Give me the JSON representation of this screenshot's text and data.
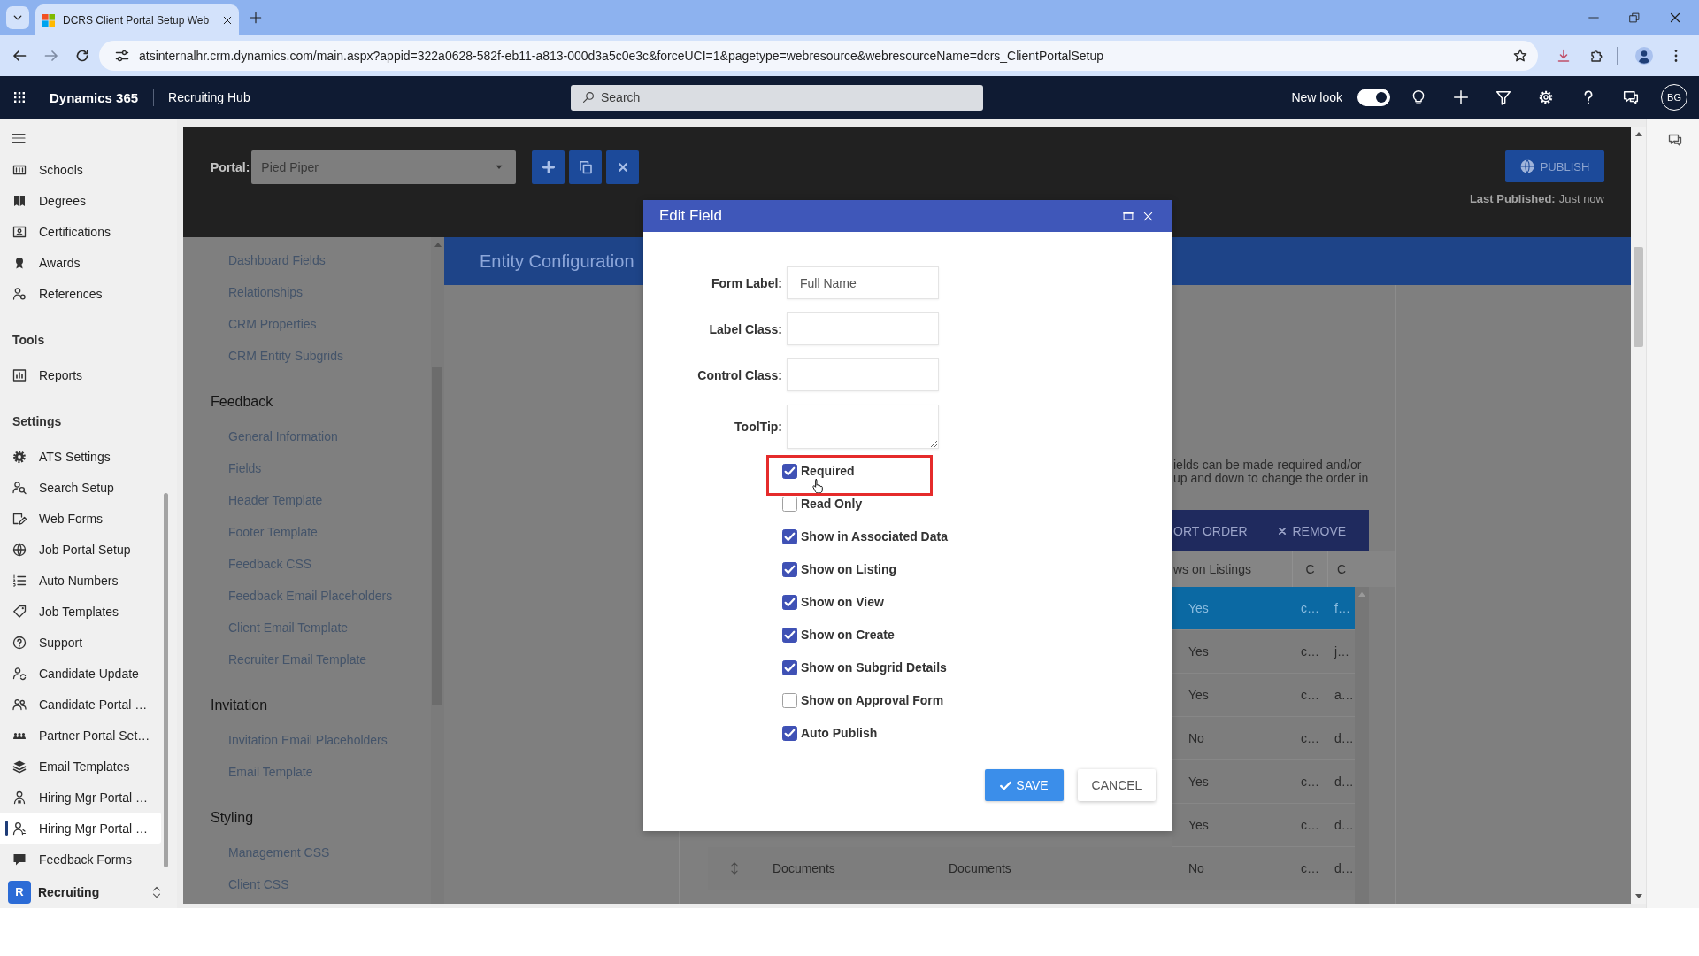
{
  "browser": {
    "tab_title": "DCRS Client Portal Setup Web",
    "url": "atsinternalhr.crm.dynamics.com/main.aspx?appid=322a0628-582f-eb11-a813-000d3a5c0e3c&forceUCI=1&pagetype=webresource&webresourceName=dcrs_ClientPortalSetup"
  },
  "app_header": {
    "app_name": "Dynamics 365",
    "area_name": "Recruiting Hub",
    "search": {
      "placeholder": "Search"
    },
    "new_look": {
      "label": "New look",
      "on": true
    },
    "avatar_initials": "BG"
  },
  "sidebar": {
    "groups": [
      {
        "items": [
          {
            "label": "Schools",
            "selected": false
          },
          {
            "label": "Degrees",
            "selected": false
          },
          {
            "label": "Certifications",
            "selected": false
          },
          {
            "label": "Awards",
            "selected": false
          },
          {
            "label": "References",
            "selected": false
          }
        ]
      },
      {
        "title": "Tools",
        "items": [
          {
            "label": "Reports",
            "selected": false
          }
        ]
      },
      {
        "title": "Settings",
        "items": [
          {
            "label": "ATS Settings",
            "selected": false
          },
          {
            "label": "Search Setup",
            "selected": false
          },
          {
            "label": "Web Forms",
            "selected": false
          },
          {
            "label": "Job Portal Setup",
            "selected": false
          },
          {
            "label": "Auto Numbers",
            "selected": false
          },
          {
            "label": "Job Templates",
            "selected": false
          },
          {
            "label": "Support",
            "selected": false
          },
          {
            "label": "Candidate Update",
            "selected": false
          },
          {
            "label": "Candidate Portal …",
            "selected": false
          },
          {
            "label": "Partner Portal Set…",
            "selected": false
          },
          {
            "label": "Email Templates",
            "selected": false
          },
          {
            "label": "Hiring Mgr Portal …",
            "selected": false
          },
          {
            "label": "Hiring Mgr Portal …",
            "selected": true
          },
          {
            "label": "Feedback Forms",
            "selected": false
          }
        ]
      }
    ],
    "area_switcher": {
      "badge": "R",
      "label": "Recruiting"
    }
  },
  "portal_bar": {
    "label": "Portal:",
    "portal": "Pied Piper",
    "publish_button": "PUBLISH",
    "last_published_label": "Last Published:",
    "last_published_value": "Just now"
  },
  "config_nav": {
    "groups": [
      {
        "items": [
          {
            "label": "Dashboard Fields",
            "selected": false
          },
          {
            "label": "Relationships",
            "selected": false
          },
          {
            "label": "CRM Properties",
            "selected": false
          },
          {
            "label": "CRM Entity Subgrids",
            "selected": false
          }
        ]
      },
      {
        "title": "Feedback",
        "items": [
          {
            "label": "General Information",
            "selected": false
          },
          {
            "label": "Fields",
            "selected": false
          },
          {
            "label": "Header Template",
            "selected": false
          },
          {
            "label": "Footer Template",
            "selected": false
          },
          {
            "label": "Feedback CSS",
            "selected": false
          },
          {
            "label": "Feedback Email Placeholders",
            "selected": false
          },
          {
            "label": "Client Email Template",
            "selected": false
          },
          {
            "label": "Recruiter Email Template",
            "selected": false
          }
        ]
      },
      {
        "title": "Invitation",
        "items": [
          {
            "label": "Invitation Email Placeholders",
            "selected": false
          },
          {
            "label": "Email Template",
            "selected": false
          }
        ]
      },
      {
        "title": "Styling",
        "items": [
          {
            "label": "Management CSS",
            "selected": false
          },
          {
            "label": "Client CSS",
            "selected": false
          }
        ]
      }
    ]
  },
  "entity_configuration": {
    "title": "Entity Configuration",
    "description_lines": [
      "ields can be made required and/or",
      "up and down to change the order in"
    ],
    "toolbar": [
      {
        "kind": "sort",
        "label": "ORT ORDER"
      },
      {
        "kind": "remove",
        "label": "REMOVE"
      }
    ],
    "table": {
      "columns": [
        "",
        "",
        "ws on Listings",
        "C",
        "C"
      ],
      "rows": [
        {
          "selected": true,
          "cells": [
            "",
            "",
            "Yes",
            "c…",
            "f…"
          ]
        },
        {
          "selected": false,
          "cells": [
            "",
            "",
            "Yes",
            "c…",
            "j…"
          ]
        },
        {
          "selected": false,
          "cells": [
            "",
            "",
            "Yes",
            "c…",
            "a…"
          ]
        },
        {
          "selected": false,
          "cells": [
            "",
            "",
            "No",
            "c…",
            "d…"
          ]
        },
        {
          "selected": false,
          "cells": [
            "",
            "",
            "Yes",
            "c…",
            "d…"
          ]
        },
        {
          "selected": false,
          "cells": [
            "",
            "",
            "Yes",
            "c…",
            "d…"
          ]
        },
        {
          "selected": false,
          "cells": [
            "Documents",
            "Documents",
            "No",
            "c…",
            "d…"
          ]
        }
      ]
    }
  },
  "dialog": {
    "title": "Edit Field",
    "fields": [
      {
        "kind": "input",
        "label": "Form Label:",
        "value": "Full Name"
      },
      {
        "kind": "input",
        "label": "Label Class:"
      },
      {
        "kind": "input",
        "label": "Control Class:"
      },
      {
        "kind": "textarea",
        "label": "ToolTip:"
      }
    ],
    "options": [
      {
        "label": "Required",
        "checked": true,
        "highlighted": true
      },
      {
        "label": "Read Only",
        "checked": false,
        "highlighted": false
      },
      {
        "label": "Show in Associated Data",
        "checked": true,
        "highlighted": false
      },
      {
        "label": "Show on Listing",
        "checked": true,
        "highlighted": false
      },
      {
        "label": "Show on View",
        "checked": true,
        "highlighted": false
      },
      {
        "label": "Show on Create",
        "checked": true,
        "highlighted": false
      },
      {
        "label": "Show on Subgrid Details",
        "checked": true,
        "highlighted": false
      },
      {
        "label": "Show on Approval Form",
        "checked": false,
        "highlighted": false
      },
      {
        "label": "Auto Publish",
        "checked": true,
        "highlighted": false
      }
    ],
    "buttons": [
      {
        "kind": "primary",
        "label": "SAVE"
      },
      {
        "kind": "secondary",
        "label": "CANCEL"
      }
    ]
  }
}
